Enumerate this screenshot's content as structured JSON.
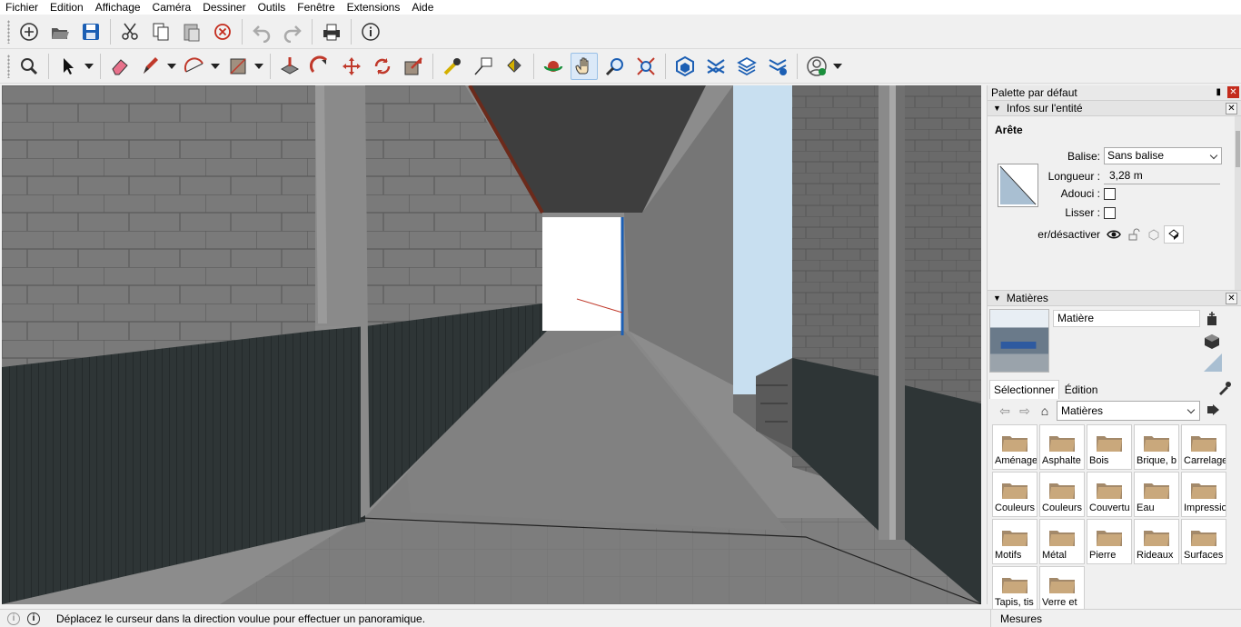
{
  "menu": [
    "Fichier",
    "Edition",
    "Affichage",
    "Caméra",
    "Dessiner",
    "Outils",
    "Fenêtre",
    "Extensions",
    "Aide"
  ],
  "panel": {
    "title": "Palette par défaut",
    "entity": {
      "section_title": "Infos sur l'entité",
      "heading": "Arête",
      "tag_label": "Balise:",
      "tag_value": "Sans balise",
      "length_label": "Longueur :",
      "length_value": "3,28 m",
      "soften_label": "Adouci :",
      "smooth_label": "Lisser :",
      "toggle_label": "er/désactiver"
    },
    "materials": {
      "section_title": "Matières",
      "material_name": "Matière",
      "tab_select": "Sélectionner",
      "tab_edit": "Édition",
      "library": "Matières",
      "folders": [
        "Aménage",
        "Asphalte",
        "Bois",
        "Brique, b",
        "Carrelage",
        "Couleurs",
        "Couleurs",
        "Couvertu",
        "Eau",
        "Impressio",
        "Motifs",
        "Métal",
        "Pierre",
        "Rideaux",
        "Surfaces",
        "Tapis, tis",
        "Verre et"
      ]
    }
  },
  "status": {
    "message": "Déplacez le curseur dans la direction voulue pour effectuer un panoramique.",
    "measures_label": "Mesures"
  },
  "colors": {
    "accent_blue": "#1c5fb4",
    "close_red": "#c42b1c",
    "active_tool": "#dbe9f8"
  },
  "icons": {
    "toolbar1": [
      "new-icon",
      "open-icon",
      "save-icon",
      "cut-icon",
      "copy-icon",
      "paste-icon",
      "erase-icon",
      "undo-icon",
      "redo-icon",
      "print-icon",
      "info-icon"
    ],
    "toolbar2": [
      "zoom-icon",
      "select-icon",
      "eraser-icon",
      "pencil-icon",
      "arc-icon",
      "rectangle-icon",
      "push-pull-icon",
      "follow-me-icon",
      "move-icon",
      "rotate-icon",
      "scale-icon",
      "tape-measure-icon",
      "text-icon",
      "paint-bucket-icon",
      "orbit-icon",
      "pan-icon",
      "zoom-window-icon",
      "zoom-extents-icon",
      "warehouse-icon",
      "extension-icon",
      "layers-icon",
      "components-icon",
      "account-icon"
    ]
  }
}
